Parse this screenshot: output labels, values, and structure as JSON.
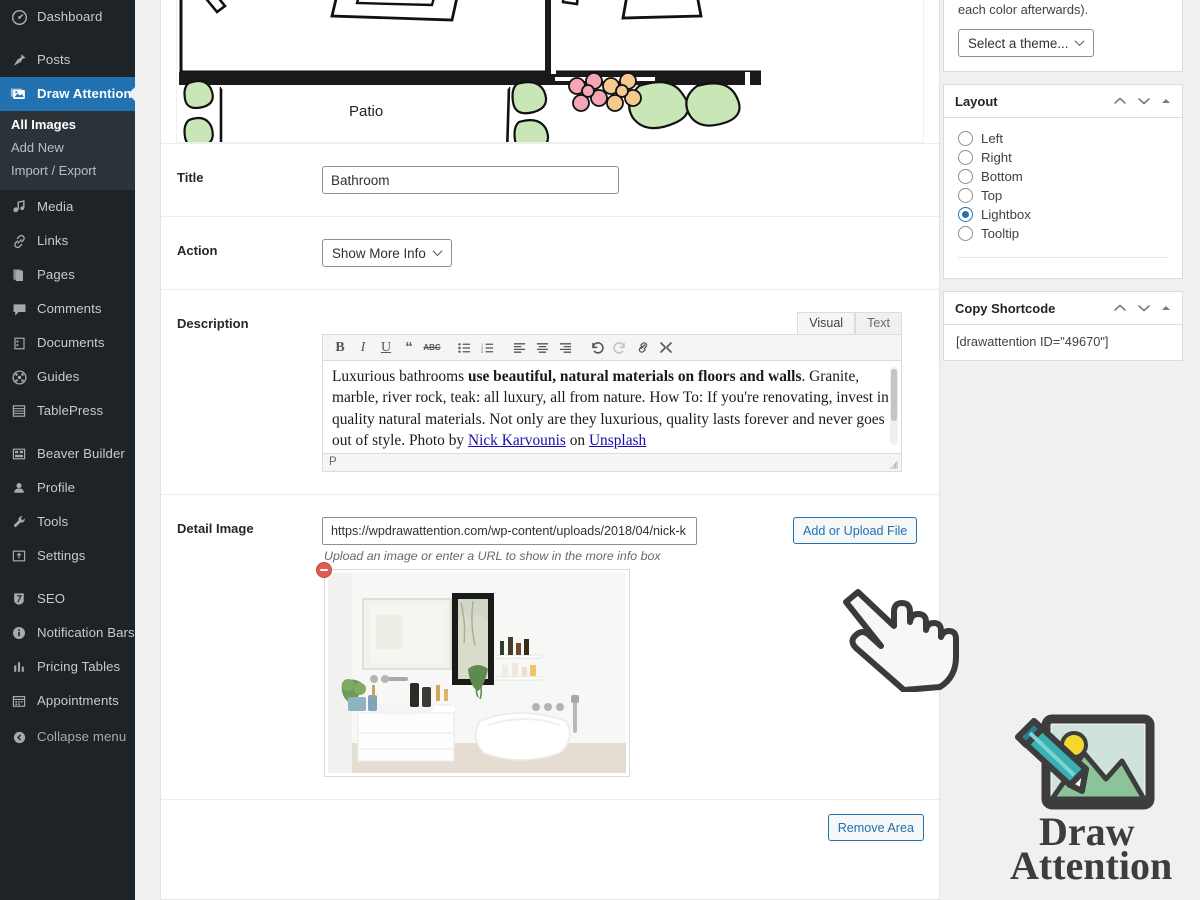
{
  "admin_menu": {
    "items": [
      {
        "label": "Dashboard",
        "icon": "dashboard-icon",
        "current": false
      },
      {
        "label": "Posts",
        "icon": "pin-icon",
        "current": false,
        "gap_before": true
      },
      {
        "label": "Draw Attention",
        "icon": "images-icon",
        "current": true
      },
      {
        "label": "Media",
        "icon": "media-icon",
        "current": false,
        "gap_before": true
      },
      {
        "label": "Links",
        "icon": "link-icon",
        "current": false
      },
      {
        "label": "Pages",
        "icon": "pages-icon",
        "current": false
      },
      {
        "label": "Comments",
        "icon": "comment-icon",
        "current": false
      },
      {
        "label": "Documents",
        "icon": "document-icon",
        "current": false
      },
      {
        "label": "Guides",
        "icon": "guides-icon",
        "current": false
      },
      {
        "label": "TablePress",
        "icon": "table-icon",
        "current": false
      },
      {
        "label": "Beaver Builder",
        "icon": "builder-icon",
        "current": false,
        "gap_before": true
      },
      {
        "label": "Profile",
        "icon": "user-icon",
        "current": false
      },
      {
        "label": "Tools",
        "icon": "wrench-icon",
        "current": false
      },
      {
        "label": "Settings",
        "icon": "settings-icon",
        "current": false
      },
      {
        "label": "SEO",
        "icon": "seo-icon",
        "current": false,
        "gap_before": true
      },
      {
        "label": "Notification Bars",
        "icon": "info-icon",
        "current": false
      },
      {
        "label": "Pricing Tables",
        "icon": "chart-icon",
        "current": false
      },
      {
        "label": "Appointments",
        "icon": "calendar-icon",
        "current": false
      }
    ],
    "submenu": [
      {
        "label": "All Images",
        "active": true
      },
      {
        "label": "Add New",
        "active": false
      },
      {
        "label": "Import / Export",
        "active": false
      }
    ],
    "collapse": {
      "label": "Collapse menu",
      "icon": "collapse-icon"
    }
  },
  "sketch": {
    "label": "Patio"
  },
  "form": {
    "title": {
      "label": "Title",
      "value": "Bathroom"
    },
    "action": {
      "label": "Action",
      "value": "Show More Info"
    },
    "description": {
      "label": "Description",
      "tabs": [
        {
          "label": "Visual",
          "active": true
        },
        {
          "label": "Text",
          "active": false
        }
      ],
      "toolbar": [
        {
          "name": "bold-icon",
          "glyph": "B"
        },
        {
          "name": "italic-icon",
          "glyph": "I"
        },
        {
          "name": "underline-icon",
          "glyph": "U"
        },
        {
          "name": "blockquote-icon",
          "glyph": "“"
        },
        {
          "name": "strikethrough-icon",
          "glyph": "ABC"
        },
        {
          "name": "unordered-list-icon",
          "glyph": ""
        },
        {
          "name": "ordered-list-icon",
          "glyph": ""
        },
        {
          "name": "align-left-icon",
          "glyph": ""
        },
        {
          "name": "align-center-icon",
          "glyph": ""
        },
        {
          "name": "align-right-icon",
          "glyph": ""
        },
        {
          "name": "undo-icon",
          "glyph": ""
        },
        {
          "name": "redo-icon",
          "glyph": ""
        },
        {
          "name": "link-icon",
          "glyph": ""
        },
        {
          "name": "fullscreen-icon",
          "glyph": ""
        }
      ],
      "text_part1": "Luxurious bathrooms ",
      "text_bold": "use beautiful, natural materials on floors and walls",
      "text_part2": ". Granite, marble, river rock, teak: all luxury, all from nature. How To: If you're renovating, invest in quality natural materials. Not only are they luxurious, quality lasts forever and never goes out of style. Photo by ",
      "link1": "Nick Karvounis",
      "text_mid": " on ",
      "link2": "Unsplash",
      "status_path": "P"
    },
    "detail_image": {
      "label": "Detail Image",
      "value": "https://wpdrawattention.com/wp-content/uploads/2018/04/nick-k",
      "help": "Upload an image or enter a URL to show in the more info box",
      "upload_button": "Add or Upload File",
      "remove_thumb_title": "Remove image"
    },
    "remove_area_button": "Remove Area"
  },
  "sidebar_panels": {
    "theme": {
      "note": "each color afterwards).",
      "select_value": "Select a theme..."
    },
    "layout": {
      "title": "Layout",
      "options": [
        {
          "label": "Left",
          "checked": false
        },
        {
          "label": "Right",
          "checked": false
        },
        {
          "label": "Bottom",
          "checked": false
        },
        {
          "label": "Top",
          "checked": false
        },
        {
          "label": "Lightbox",
          "checked": true
        },
        {
          "label": "Tooltip",
          "checked": false
        }
      ]
    },
    "shortcode": {
      "title": "Copy Shortcode",
      "value": "[drawattention ID=\"49670\"]"
    }
  },
  "overlay": {
    "cursor": "pointing-hand-cursor",
    "logo": {
      "line1": "Draw",
      "line2": "Attention"
    }
  },
  "colors": {
    "admin_bg": "#1d2327",
    "submenu_bg": "#2c3338",
    "accent_blue": "#2271b1",
    "page_bg": "#f0f0f1",
    "logo_teal": "#2a9d9d",
    "logo_green": "#8cc49a",
    "logo_sun": "#f5d82e",
    "remove_red": "#e25b52"
  }
}
